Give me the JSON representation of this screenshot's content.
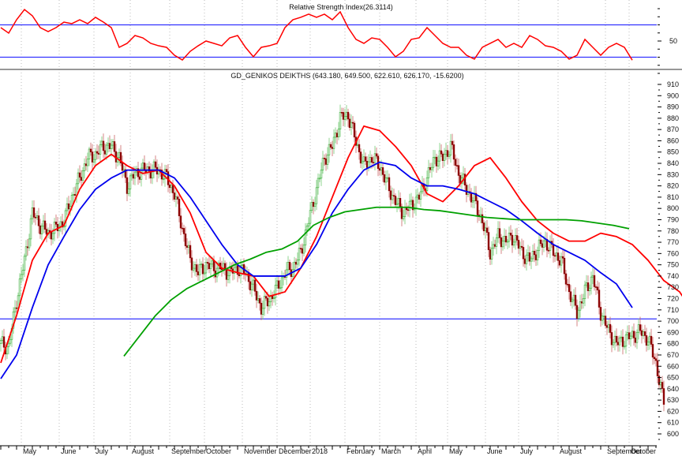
{
  "chart_data": [
    {
      "type": "line",
      "title": "Relative Strength Index(26.3114)",
      "x_unit": "trading day index",
      "x_step": 5,
      "ylim": [
        0,
        100
      ],
      "y_tick_labels": [
        "50"
      ],
      "reference_levels": [
        70,
        30
      ],
      "series": [
        {
          "name": "RSI",
          "color": "#ff0000",
          "values": [
            66.6,
            59.8,
            76.3,
            89,
            81.2,
            66.6,
            61.7,
            66.6,
            73.4,
            71.5,
            76.3,
            71.5,
            79.3,
            73.4,
            66.6,
            42.2,
            47.1,
            56.8,
            53.9,
            47.1,
            44.1,
            42.2,
            32.4,
            26.6,
            37.3,
            44.1,
            50,
            47.1,
            44.1,
            53.9,
            56.8,
            42.2,
            30.5,
            42.2,
            44.1,
            47.1,
            66.6,
            76.3,
            79.3,
            83.2,
            79.3,
            83.2,
            76.3,
            86.1,
            66.6,
            52,
            47.1,
            53.9,
            52,
            42.2,
            30.5,
            37.3,
            52,
            53.9,
            66.6,
            56.8,
            47.1,
            42.2,
            42.2,
            32.4,
            27.6,
            42.2,
            47.1,
            52,
            42.2,
            47.1,
            42.2,
            56.8,
            52,
            44.1,
            42.2,
            37.3,
            27.6,
            32.4,
            52,
            42.2,
            32.4,
            42.2,
            47.1,
            42.2,
            26.3
          ]
        }
      ]
    },
    {
      "type": "candlestick",
      "title": "GD_GENIKOS DEIKTHS (643.180, 649.500, 622.610, 626.170, -15.6200)",
      "x_unit": "trading day index",
      "x_step": 5,
      "ylim": [
        598,
        916
      ],
      "y_ticks": [
        600,
        610,
        620,
        630,
        640,
        650,
        660,
        670,
        680,
        690,
        700,
        710,
        720,
        730,
        740,
        750,
        760,
        770,
        780,
        790,
        800,
        810,
        820,
        830,
        840,
        850,
        860,
        870,
        880,
        890,
        900,
        910
      ],
      "x_tick_labels": [
        {
          "label": "May",
          "day": 15
        },
        {
          "label": "June",
          "day": 39
        },
        {
          "label": "July",
          "day": 61
        },
        {
          "label": "August",
          "day": 84
        },
        {
          "label": "September",
          "day": 109
        },
        {
          "label": "October",
          "day": 131
        },
        {
          "label": "November",
          "day": 155
        },
        {
          "label": "December",
          "day": 177
        },
        {
          "label": "2018",
          "day": 198
        },
        {
          "label": "February",
          "day": 220
        },
        {
          "label": "March",
          "day": 242
        },
        {
          "label": "April",
          "day": 265
        },
        {
          "label": "May",
          "day": 285
        },
        {
          "label": "June",
          "day": 309
        },
        {
          "label": "July",
          "day": 330
        },
        {
          "label": "August",
          "day": 355
        },
        {
          "label": "September",
          "day": 385
        },
        {
          "label": "October",
          "day": 400
        }
      ],
      "horizontal_line": 702,
      "up_color": "#33aa33",
      "down_color": "#8b0000",
      "closes": [
        680,
        677,
        719,
        754,
        796,
        785,
        778,
        782,
        789,
        810,
        827,
        845,
        848,
        855,
        855,
        845,
        820,
        831,
        834,
        834,
        834,
        827,
        813,
        782,
        754,
        743,
        750,
        747,
        747,
        743,
        747,
        743,
        729,
        712,
        719,
        729,
        743,
        747,
        761,
        789,
        817,
        845,
        855,
        880,
        883,
        859,
        838,
        845,
        838,
        820,
        806,
        796,
        803,
        810,
        827,
        845,
        845,
        855,
        831,
        817,
        806,
        789,
        761,
        775,
        771,
        775,
        761,
        754,
        764,
        771,
        761,
        754,
        726,
        708,
        726,
        740,
        708,
        691,
        680,
        684,
        687,
        691,
        684,
        663,
        626.17
      ],
      "moving_averages": [
        {
          "name": "MA short",
          "color": "#ff0000",
          "start_day": 0,
          "step": 10,
          "values": [
            663,
            705,
            754,
            778,
            785,
            817,
            838,
            848,
            838,
            831,
            834,
            820,
            796,
            761,
            747,
            743,
            740,
            722,
            726,
            747,
            775,
            810,
            845,
            873,
            869,
            855,
            838,
            813,
            806,
            820,
            838,
            845,
            827,
            806,
            789,
            778,
            771,
            771,
            778,
            775,
            768,
            754,
            736,
            726,
            705,
            698,
            691,
            680
          ]
        },
        {
          "name": "MA medium",
          "color": "#0000ee",
          "start_day": 0,
          "step": 10,
          "values": [
            649,
            670,
            712,
            750,
            775,
            799,
            817,
            827,
            834,
            834,
            834,
            827,
            810,
            789,
            768,
            750,
            740,
            740,
            740,
            747,
            768,
            796,
            817,
            834,
            841,
            838,
            827,
            820,
            820,
            817,
            813,
            806,
            799,
            789,
            778,
            768,
            761,
            754,
            743,
            733,
            712
          ]
        },
        {
          "name": "MA long",
          "color": "#00a000",
          "start_day": 78,
          "step": 10,
          "values": [
            669,
            687,
            705,
            719,
            729,
            736,
            743,
            750,
            755,
            761,
            764,
            771,
            785,
            792,
            797,
            799,
            801,
            801,
            801,
            799,
            798,
            796,
            794,
            792,
            791,
            790,
            790,
            790,
            790,
            789,
            787,
            785,
            782
          ]
        }
      ]
    }
  ]
}
